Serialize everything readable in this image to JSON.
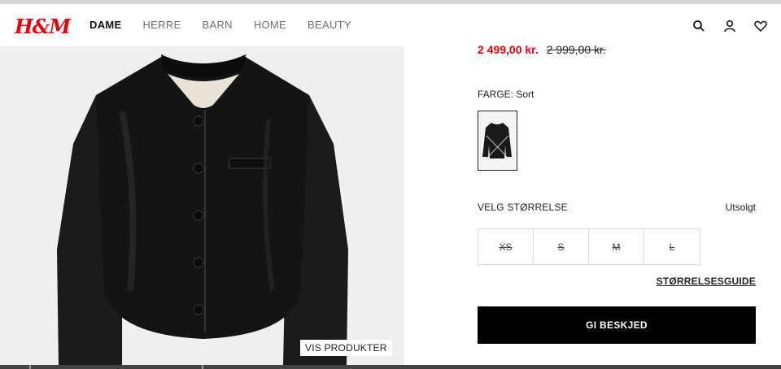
{
  "brand": {
    "logo_text": "H&M",
    "logo_color": "#e50010"
  },
  "nav": {
    "items": [
      "DAME",
      "HERRE",
      "BARN",
      "HOME",
      "BEAUTY"
    ],
    "active": "DAME"
  },
  "header_icons": [
    "search-icon",
    "account-icon",
    "heart-icon"
  ],
  "gallery": {
    "button_label": "VIS PRODUKTER"
  },
  "product": {
    "price_sale": "2 499,00 kr.",
    "price_original": "2 999,00 kr.",
    "price_color": "#e50010",
    "color_label": "FARGE: Sort",
    "size_heading": "VELG STØRRELSE",
    "availability": "Utsolgt",
    "sizes": [
      "XS",
      "S",
      "M",
      "L"
    ],
    "size_guide_label": "STØRRELSESGUIDE",
    "notify_label": "GI BESKJED"
  }
}
